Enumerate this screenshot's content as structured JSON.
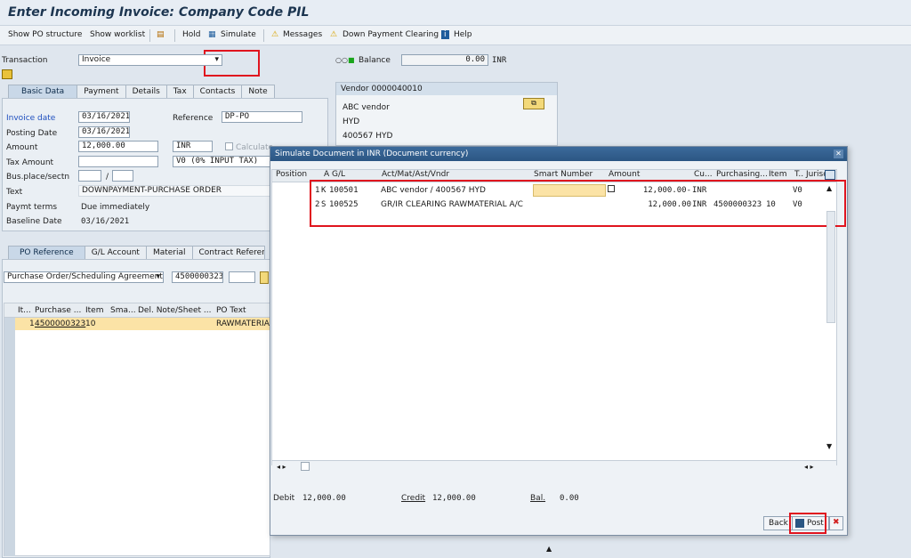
{
  "window": {
    "title": "Enter Incoming Invoice: Company Code PIL"
  },
  "toolbar": {
    "show_po": "Show PO structure",
    "show_worklist": "Show worklist",
    "hold": "Hold",
    "simulate": "Simulate",
    "messages": "Messages",
    "down_payment": "Down Payment Clearing",
    "help": "Help"
  },
  "header": {
    "transaction_label": "Transaction",
    "transaction_value": "Invoice",
    "balance_label": "Balance",
    "balance_value": "0.00",
    "balance_currency": "INR"
  },
  "tabs": [
    "Basic Data",
    "Payment",
    "Details",
    "Tax",
    "Contacts",
    "Note"
  ],
  "basic": {
    "invoice_date_label": "Invoice date",
    "invoice_date": "03/16/2021",
    "reference_label": "Reference",
    "reference": "DP-PO",
    "posting_date_label": "Posting Date",
    "posting_date": "03/16/2021",
    "amount_label": "Amount",
    "amount": "12,000.00",
    "currency": "INR",
    "calc_tax": "Calculate",
    "tax_amount_label": "Tax Amount",
    "tax_code": "V0 (0% INPUT TAX)",
    "bus_place_label": "Bus.place/sectn",
    "slash": "/",
    "text_label": "Text",
    "text": "DOWNPAYMENT-PURCHASE ORDER",
    "paymt_terms_label": "Paymt terms",
    "paymt_terms": "Due immediately",
    "baseline_label": "Baseline Date",
    "baseline": "03/16/2021"
  },
  "vendor": {
    "header": "Vendor 0000040010",
    "name": "ABC vendor",
    "city": "HYD",
    "postal": "400567 HYD"
  },
  "ref_tabs": [
    "PO Reference",
    "G/L Account",
    "Material",
    "Contract Reference"
  ],
  "po_ref": {
    "select": "Purchase Order/Scheduling Agreement",
    "po_number": "4500000323"
  },
  "po_table": {
    "headers": [
      "It...",
      "Purchase ...",
      "Item",
      "Sma...",
      "Del. Note/Sheet ...",
      "PO Text"
    ],
    "row": {
      "item": "1",
      "po": "4500000323",
      "line": "10",
      "text": "RAWMATERIAL"
    }
  },
  "dialog": {
    "title": "Simulate Document in INR (Document currency)",
    "headers": [
      "Position",
      "A",
      "G/L",
      "Act/Mat/Ast/Vndr",
      "Smart Number",
      "Amount",
      "Cu...",
      "Purchasing...",
      "Item",
      "T..",
      "Jurisd"
    ],
    "rows": [
      {
        "pos": "1",
        "a": "K",
        "gl": "100501",
        "acct": "ABC vendor / 400567 HYD",
        "amount": "12,000.00-",
        "cur": "INR",
        "po": "",
        "item": "",
        "t": "V0"
      },
      {
        "pos": "2",
        "a": "S",
        "gl": "100525",
        "acct": "GR/IR CLEARING RAWMATERIAL A/C",
        "amount": "12,000.00",
        "cur": "INR",
        "po": "4500000323",
        "item": "10",
        "t": "V0"
      }
    ],
    "debit_label": "Debit",
    "debit": "12,000.00",
    "credit_label": "Credit",
    "credit": "12,000.00",
    "bal_label": "Bal.",
    "bal": "0.00",
    "back": "Back",
    "post": "Post"
  },
  "colors": {
    "highlight": "#e0141e",
    "title_blue": "#2b5683",
    "row_yellow": "#fbe3a6"
  }
}
